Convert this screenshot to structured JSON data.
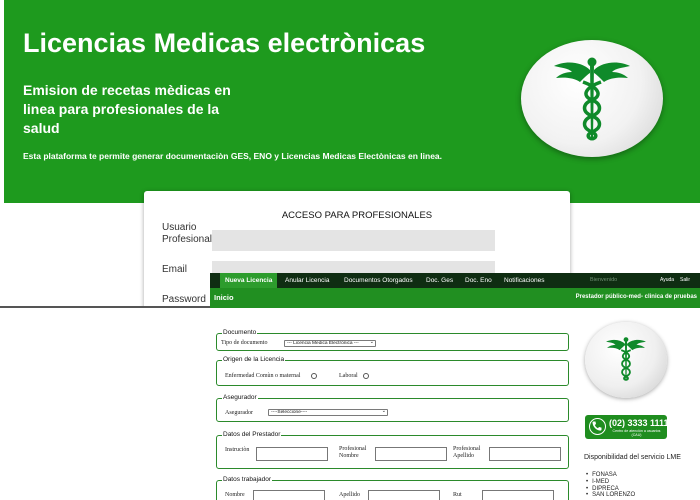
{
  "hero": {
    "title": "Licencias Medicas electrònicas",
    "subtitle": "Emision de recetas mèdicas en linea para profesionales de la salud",
    "description": "Esta plataforma te permite generar documentaciòn GES, ENO y Licencias Medicas Electònicas en linea."
  },
  "login": {
    "title": "ACCESO PARA PROFESIONALES",
    "user_label": "Usuario Profesional",
    "email_label": "Email",
    "password_label": "Password"
  },
  "nav": {
    "items": [
      "Nueva Licencia",
      "Anular Licencia",
      "Documentos Otorgados",
      "Doc. Ges",
      "Doc. Eno",
      "Notificaciones"
    ],
    "user": "Bienvenido",
    "help": "Ayuda",
    "exit": "Salir"
  },
  "bar": {
    "home": "Inicio",
    "provider": "Prestador público-med- clinica de pruebas"
  },
  "form": {
    "documento": {
      "legend": "Documento",
      "label": "Tipo de documento",
      "select_value": "--- Licencia Medica Electrònica ---"
    },
    "origen": {
      "legend": "Origen de la Licencia",
      "option1": "Enfermedad Comùn o maternal",
      "option2": "Laboral"
    },
    "asegurador": {
      "legend": "Asegurador",
      "label": "Asegurador",
      "select_value": "----Seleccione----"
    },
    "prestador": {
      "legend": "Datos del Prestador",
      "institucion": "Instruciòn",
      "nombre": "Profesional Nombre",
      "apellido": "Profesional Apellido"
    },
    "trabajador": {
      "legend": "Datos trabajador",
      "nombre": "Nombre",
      "apellido": "Apellido",
      "rut": "Rut"
    }
  },
  "side": {
    "phone_number": "(02) 3333 1111",
    "phone_sub": "Centro de atención a usuarios (CAU)",
    "availability_title": "Disponibilidad del servicio LME",
    "services": [
      "FONASA",
      "I-MED",
      "DIPRECA",
      "SAN LORENZO"
    ]
  },
  "colors": {
    "brand_green": "#1e9a1e",
    "nav_dark": "#0f2d12",
    "symbol_green": "#0f8a2a"
  },
  "icons": {
    "hero": "caduceus-icon",
    "side": "caduceus-icon",
    "phone": "phone-icon"
  }
}
